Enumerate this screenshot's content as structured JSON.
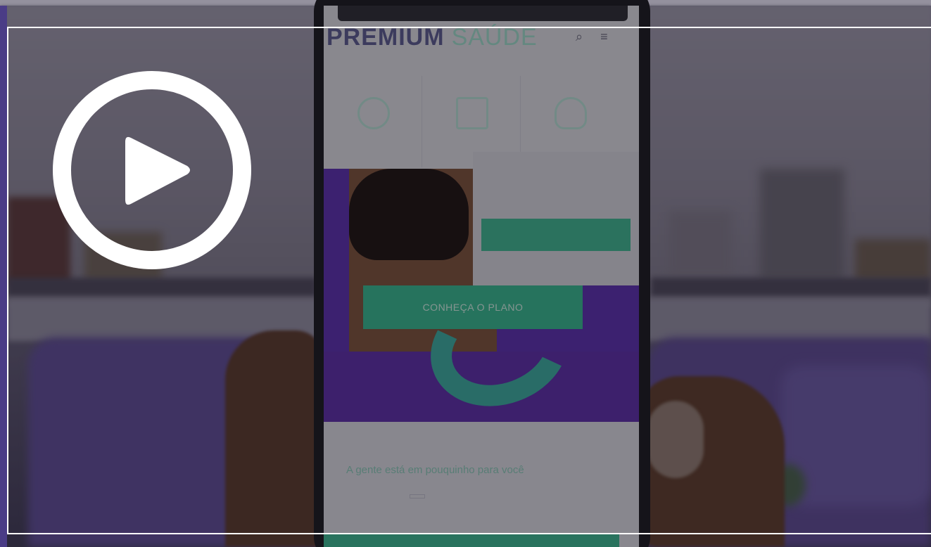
{
  "video": {
    "play_icon": "play-circle-icon",
    "overlay_color": "#0c0a16",
    "frame_color": "#ffffff"
  },
  "phone_screen": {
    "logo_part1": "PREMIUM",
    "logo_part2": "SAÚDE",
    "header_icons": "⌕ ≡",
    "menu": [
      {
        "icon": "globe-icon"
      },
      {
        "icon": "document-icon"
      },
      {
        "icon": "lightbulb-icon"
      }
    ],
    "hero_cta": "CONHEÇA O PLANO",
    "tagline": "A gente está em pouquinho para você"
  },
  "colors": {
    "accent_green": "#36b48a",
    "brand_purple": "#5a2fa8"
  }
}
